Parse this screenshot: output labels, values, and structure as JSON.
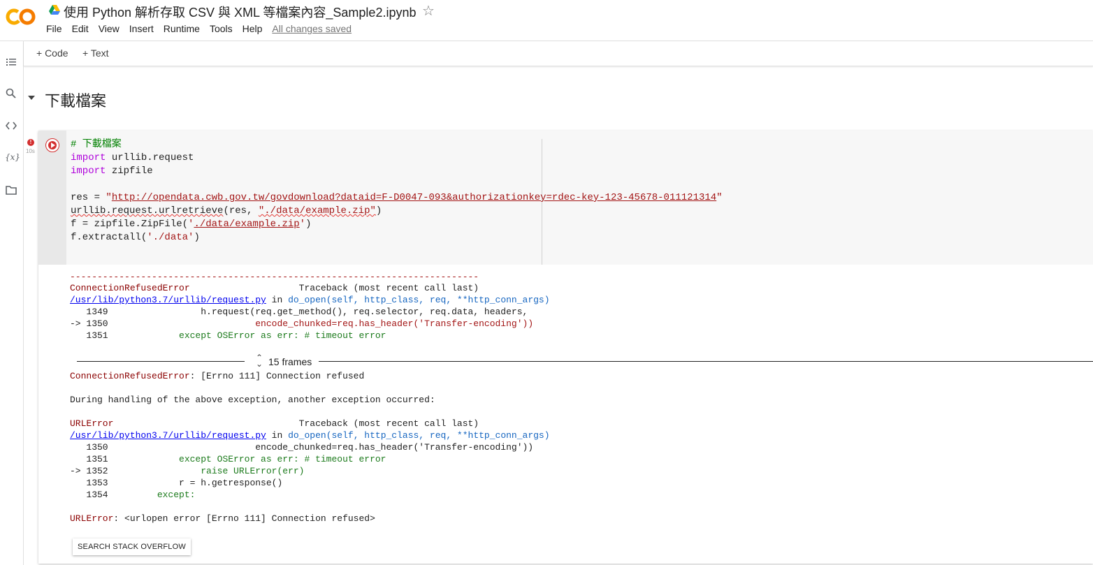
{
  "app": {
    "title": "使用 Python 解析存取 CSV 與 XML 等檔案內容_Sample2.ipynb",
    "menu": [
      "File",
      "Edit",
      "View",
      "Insert",
      "Runtime",
      "Tools",
      "Help"
    ],
    "saved_status": "All changes saved"
  },
  "toolbar": {
    "add_code": "+ Code",
    "add_text": "+ Text"
  },
  "sidebar": {
    "icons": [
      "toc-icon",
      "search-icon",
      "code-snippets-icon",
      "variables-icon",
      "files-icon"
    ],
    "variables_glyph": "{x}"
  },
  "section": {
    "title": "下載檔案"
  },
  "cell": {
    "exec_time": "10s",
    "error_badge": "!",
    "code": {
      "line1": "# 下載檔案",
      "kw_import": "import",
      "mod_urllib": " urllib.request",
      "mod_zipfile": " zipfile",
      "res_prefix": "res = ",
      "res_quote_open": "\"",
      "res_url": "http://opendata.cwb.gov.tw/govdownload?dataid=F-D0047-093&authorizationkey=rdec-key-123-45678-011121314",
      "res_quote_close": "\"",
      "line6_a": "urllib.request.urlretrieve",
      "line6_b": "(res, ",
      "line6_str": "\"./data/example.zip\"",
      "line6_c": ")",
      "line7_a": "f = zipfile.ZipFile(",
      "line7_q1": "'",
      "line7_str": "./data/example.zip",
      "line7_q2": "'",
      "line7_c": ")",
      "line8_a": "f.extractall(",
      "line8_str": "'./data'",
      "line8_c": ")"
    },
    "output": {
      "dashes": "---------------------------------------------------------------------------",
      "err1_name": "ConnectionRefusedError",
      "traceback_label": "                    Traceback (most recent call last)",
      "file_path": "/usr/lib/python3.7/urllib/request.py",
      "in_word": " in ",
      "func_name": "do_open",
      "func_args": "(self, http_class, req, **http_conn_args)",
      "t1_l1349": "   1349                 h.request(req.get_method(), req.selector, req.data, headers,",
      "t1_arrow": "-> 1350                           ",
      "t1_l1350": "encode_chunked=req.has_header('Transfer-encoding'))",
      "t1_l1351_num": "   1351             ",
      "t1_l1351_code": "except OSError as err: # timeout error",
      "frames": "15 frames",
      "err1_msg": ": [Errno 111] Connection refused",
      "during": "During handling of the above exception, another exception occurred:",
      "err2_name": "URLError",
      "traceback_label2": "                                  Traceback (most recent call last)",
      "t2_l1350": "   1350                           encode_chunked=req.has_header('Transfer-encoding'))",
      "t2_l1351_num": "   1351             ",
      "t2_l1351_code": "except OSError as err: # timeout error",
      "t2_l1352_arrow": "-> 1352                 ",
      "t2_l1352_code": "raise URLError(err)",
      "t2_l1353_num": "   1353             ",
      "t2_l1353_code": "r = h.getresponse()",
      "t2_l1354_num": "   1354         ",
      "t2_l1354_code": "except:",
      "err2_msg": ": <urlopen error [Errno 111] Connection refused>"
    },
    "so_button": "SEARCH STACK OVERFLOW"
  },
  "colors": {
    "accent_orange": "#f9ab00",
    "error_red": "#d32f2f"
  }
}
